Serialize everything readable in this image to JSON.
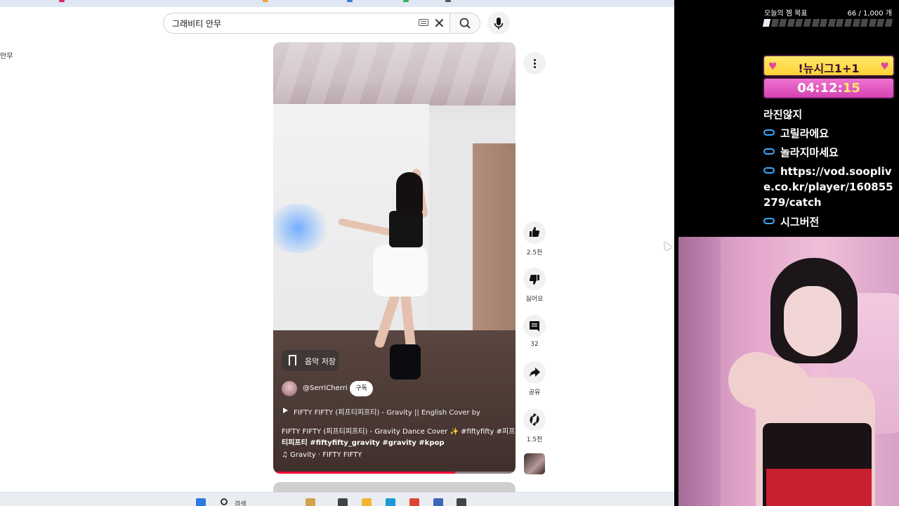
{
  "browser": {
    "search": {
      "query": "그래비티 안무"
    },
    "left_snippet": "안무"
  },
  "short": {
    "save_chip": "음악 저장",
    "channel": "@SerriCherri",
    "subscribe": "구독",
    "sound_title": "FIFTY FIFTY (피프티피프티) - Gravity || English Cover by",
    "description_line_1": "FIFTY FIFTY (피프티피프티) - Gravity Dance Cover ✨ #fiftyfifty #피프",
    "description_line_2": "티피프티 #fiftyfifty_gravity #gravity #kpop",
    "music": "Gravity · FIFTY FIFTY",
    "progress": 0.75
  },
  "actions": {
    "like_count": "2.5천",
    "dislike_label": "싫어요",
    "comment_count": "32",
    "share_label": "공유",
    "remix_count": "1.5천"
  },
  "taskbar": {
    "search_label": "검색"
  },
  "overlay": {
    "goal_label": "오늘의 젬 목표",
    "goal_count": "66 / 1,000 개",
    "goal_fraction": 0.066,
    "promo": "!뉴시그1+1",
    "timer_hm": "04:12:",
    "timer_s": "15",
    "chat": [
      "라진않지",
      "고릴라에요",
      "놀라지마세요",
      "https://vod.sooplive.co.kr/player/160855279/catch",
      "시그버전"
    ]
  },
  "colors": {
    "youtube_red": "#ff0033",
    "promo_yellow": "#ffd236",
    "timer_pink": "#d542b4",
    "chat_icon_blue": "#3fa8ff"
  },
  "icons": {
    "search": "search-icon",
    "mic": "mic-icon",
    "like": "thumbs-up-icon",
    "dislike": "thumbs-down-icon",
    "comment": "comment-icon",
    "share": "share-icon",
    "remix": "remix-icon",
    "more": "more-vert-icon",
    "chat": "infinity-badge-icon"
  }
}
